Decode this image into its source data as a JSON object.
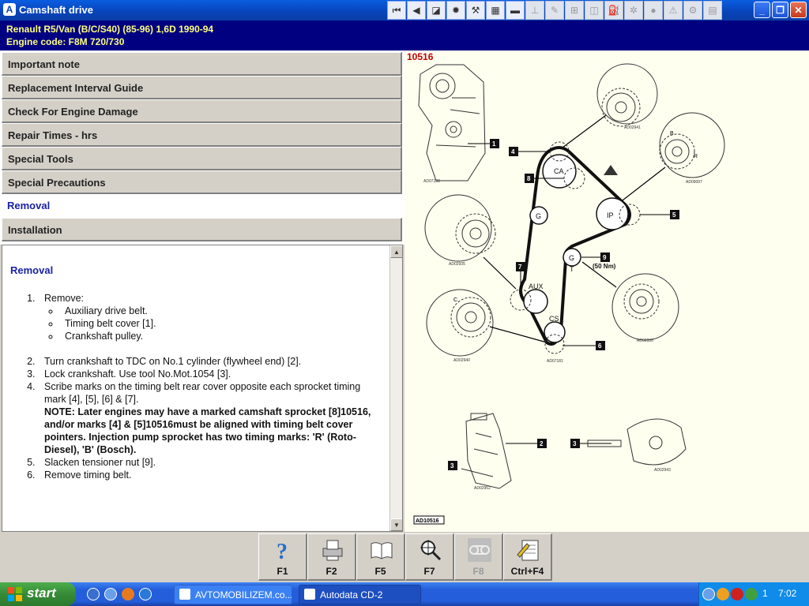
{
  "window": {
    "title": "Camshaft drive",
    "app_icon": "autodata-icon"
  },
  "toolbar": {
    "buttons": [
      {
        "name": "first-page-icon",
        "glyph": "⏮",
        "enabled": true
      },
      {
        "name": "back-icon",
        "glyph": "◀",
        "enabled": true
      },
      {
        "name": "engine-diagram-icon",
        "glyph": "◪",
        "enabled": true
      },
      {
        "name": "settings-wheel-icon",
        "glyph": "✹",
        "enabled": true
      },
      {
        "name": "tools-icon",
        "glyph": "⚒",
        "enabled": true
      },
      {
        "name": "diagnostics-icon",
        "glyph": "▦",
        "enabled": true
      },
      {
        "name": "car-icon",
        "glyph": "▬",
        "enabled": true
      },
      {
        "name": "lift-icon",
        "glyph": "⊥",
        "enabled": false
      },
      {
        "name": "spanner-icon",
        "glyph": "✎",
        "enabled": false
      },
      {
        "name": "gearbox-icon",
        "glyph": "⊞",
        "enabled": false
      },
      {
        "name": "brake-icon",
        "glyph": "◫",
        "enabled": false
      },
      {
        "name": "fuel-icon",
        "glyph": "⛽",
        "enabled": false
      },
      {
        "name": "fan-icon",
        "glyph": "✲",
        "enabled": false
      },
      {
        "name": "airbag-icon",
        "glyph": "●",
        "enabled": false
      },
      {
        "name": "warning-icon",
        "glyph": "⚠",
        "enabled": false
      },
      {
        "name": "service-icon",
        "glyph": "⚙",
        "enabled": false
      },
      {
        "name": "document-icon",
        "glyph": "▤",
        "enabled": false
      }
    ]
  },
  "window_controls": {
    "minimize": "_",
    "restore": "❐",
    "close": "✕"
  },
  "vehicle": {
    "line1": "Renault   R5/Van (B/C/S40) (85-96) 1,6D   1990-94",
    "line2": "Engine code: F8M 720/730"
  },
  "nav": {
    "items": [
      {
        "label": "Important note",
        "active": false
      },
      {
        "label": "Replacement Interval Guide",
        "active": false
      },
      {
        "label": "Check For Engine Damage",
        "active": false
      },
      {
        "label": "Repair Times - hrs",
        "active": false
      },
      {
        "label": "Special Tools",
        "active": false
      },
      {
        "label": "Special Precautions",
        "active": false
      },
      {
        "label": "Removal",
        "active": true
      },
      {
        "label": "Installation",
        "active": false
      }
    ]
  },
  "content": {
    "heading": "Removal",
    "steps": [
      "Remove:",
      "Turn crankshaft to TDC on No.1 cylinder (flywheel end) [2].",
      "Lock crankshaft. Use tool No.Mot.1054 [3].",
      "Scribe marks on the timing belt rear cover opposite each sprocket timing mark [4], [5], [6] & [7].",
      "Slacken tensioner nut [9].",
      "Remove timing belt."
    ],
    "substeps": [
      "Auxiliary drive belt.",
      "Timing belt cover [1].",
      "Crankshaft pulley."
    ],
    "note": "NOTE: Later engines may have a marked camshaft sprocket [8]10516, and/or marks [4] & [5]10516must be aligned with timing belt cover pointers. Injection pump sprocket has two timing marks: 'R' (Roto-Diesel), 'B' (Bosch)."
  },
  "diagram": {
    "ref_number": "10516",
    "footer_code": "AD10516",
    "callouts": [
      "1",
      "2",
      "3",
      "4",
      "5",
      "6",
      "7",
      "8",
      "9"
    ],
    "torque": "(50 Nm)",
    "sprockets": {
      "camshaft": "CA",
      "injection_pump": "IP",
      "auxiliary": "AUX",
      "crankshaft": "CS",
      "idler": "G",
      "tensioner": "T"
    },
    "detail_codes": [
      "AD07188",
      "AD02941",
      "AD09097",
      "AD02935",
      "AD02950",
      "AD02940",
      "AD07181",
      "AD02952",
      "AD02943"
    ],
    "inner_letters": {
      "bosch": "B",
      "roto": "R",
      "crank": "C",
      "tensioner": "G"
    }
  },
  "fn_keys": [
    {
      "label": "F1",
      "icon": "help-icon",
      "enabled": true
    },
    {
      "label": "F2",
      "icon": "printer-icon",
      "enabled": true
    },
    {
      "label": "F5",
      "icon": "book-icon",
      "enabled": true
    },
    {
      "label": "F7",
      "icon": "zoom-icon",
      "enabled": true
    },
    {
      "label": "F8",
      "icon": "belt-icon",
      "enabled": false
    },
    {
      "label": "Ctrl+F4",
      "icon": "notes-icon",
      "enabled": true
    }
  ],
  "taskbar": {
    "start_label": "start",
    "tasks": [
      {
        "label": "AVTOMOBILIZEM.co...",
        "active": false
      },
      {
        "label": "Autodata CD-2",
        "active": true
      }
    ],
    "tray_number": "1",
    "clock": "7:02"
  },
  "colors": {
    "title_blue": "#0843b8",
    "vehicle_bar": "#000080",
    "vehicle_text": "#ffff80",
    "active_nav": "#1a22a6",
    "diagram_ref": "#c00000"
  }
}
